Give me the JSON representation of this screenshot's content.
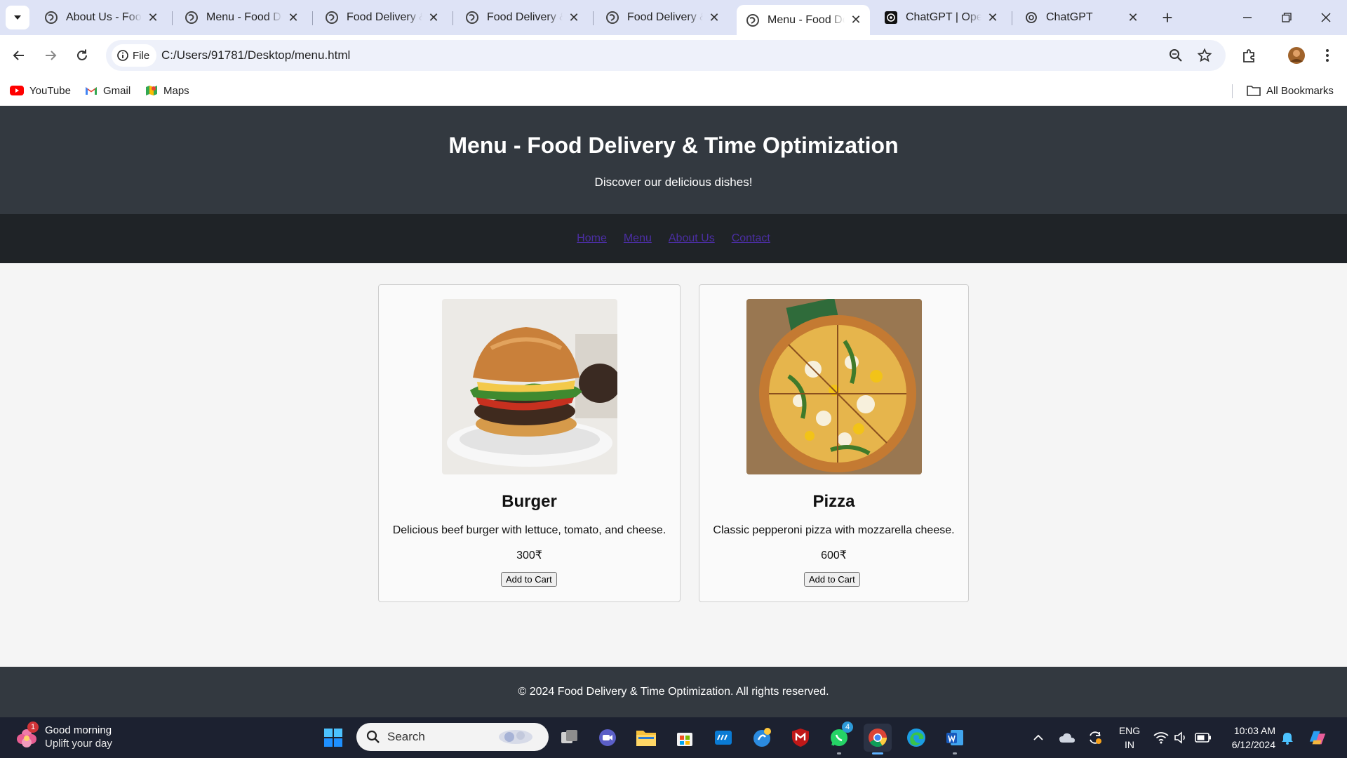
{
  "browser": {
    "tabs": [
      {
        "title": "About Us - Food Delivery & Time Optimization",
        "active": false,
        "favicon": "globe-icon"
      },
      {
        "title": "Menu - Food Delivery & Time Optimization",
        "active": false,
        "favicon": "globe-icon"
      },
      {
        "title": "Food Delivery & Time Optimization",
        "active": false,
        "favicon": "globe-icon"
      },
      {
        "title": "Food Delivery & Time Optimization",
        "active": false,
        "favicon": "globe-icon"
      },
      {
        "title": "Food Delivery & Time Optimization",
        "active": false,
        "favicon": "globe-icon"
      },
      {
        "title": "Menu - Food Delivery & Time Optimization",
        "active": true,
        "favicon": "globe-icon"
      },
      {
        "title": "ChatGPT | OpenAI",
        "active": false,
        "favicon": "openai-icon"
      },
      {
        "title": "ChatGPT",
        "active": false,
        "favicon": "openai-icon"
      }
    ],
    "address": {
      "chip_label": "File",
      "url": "C:/Users/91781/Desktop/menu.html"
    },
    "bookmarks": [
      {
        "label": "YouTube",
        "icon": "youtube-icon"
      },
      {
        "label": "Gmail",
        "icon": "gmail-icon"
      },
      {
        "label": "Maps",
        "icon": "maps-icon"
      }
    ],
    "all_bookmarks_label": "All Bookmarks"
  },
  "site": {
    "title": "Menu - Food Delivery & Time Optimization",
    "subtitle": "Discover our delicious dishes!",
    "nav": [
      "Home",
      "Menu",
      "About Us",
      "Contact"
    ],
    "nav_link_color": "#4b2ea3",
    "header_color": "#333940",
    "nav_bg_color": "#1f2327",
    "items": [
      {
        "name": "Burger",
        "description": "Delicious beef burger with lettuce, tomato, and cheese.",
        "price": "300₹",
        "button": "Add to Cart",
        "image": "burger-photo"
      },
      {
        "name": "Pizza",
        "description": "Classic pepperoni pizza with mozzarella cheese.",
        "price": "600₹",
        "button": "Add to Cart",
        "image": "pizza-photo"
      }
    ],
    "footer": "© 2024 Food Delivery & Time Optimization. All rights reserved."
  },
  "taskbar": {
    "weather": {
      "line1": "Good morning",
      "line2": "Uplift your day",
      "badge": "1"
    },
    "search_placeholder": "Search",
    "whatsapp_badge": "4",
    "language": {
      "line1": "ENG",
      "line2": "IN"
    },
    "clock": {
      "time": "10:03 AM",
      "date": "6/12/2024"
    }
  }
}
